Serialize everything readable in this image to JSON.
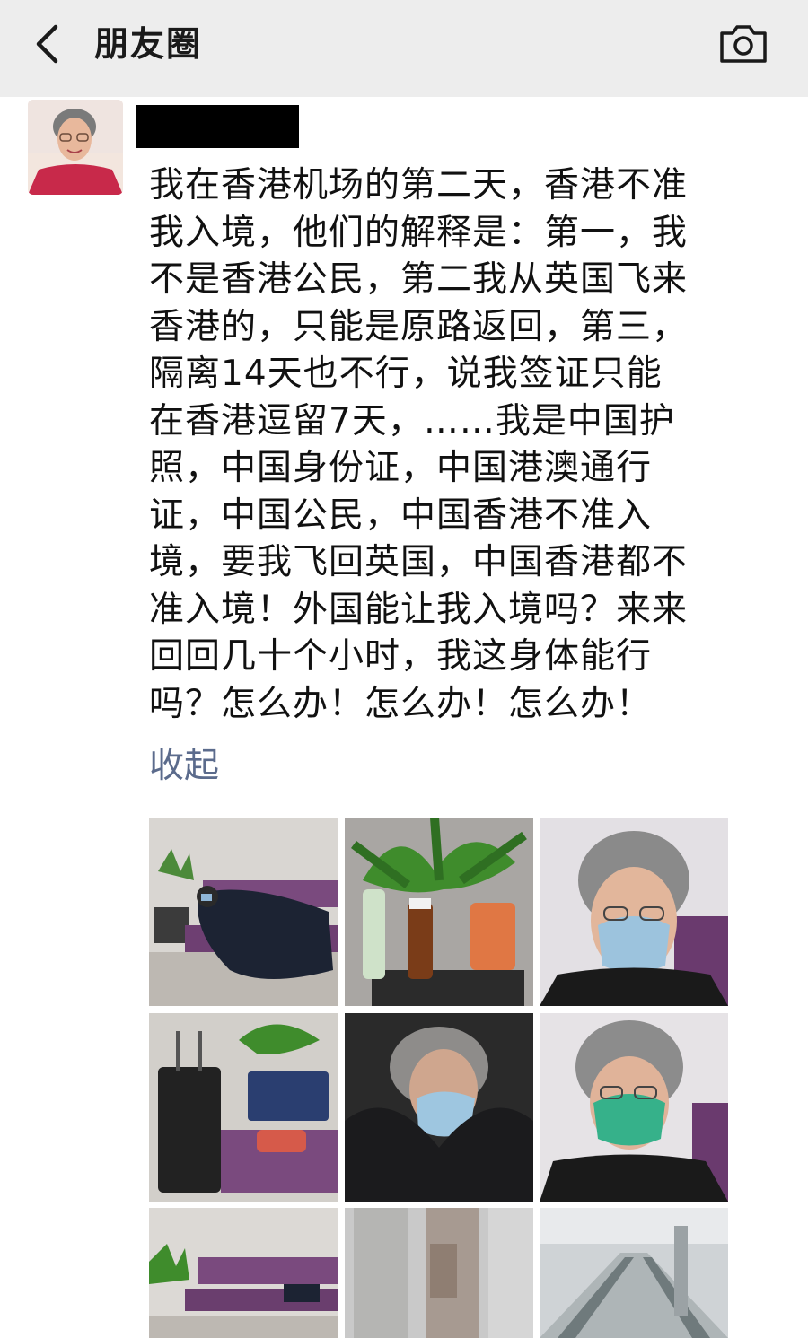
{
  "header": {
    "title": "朋友圈",
    "back_icon": "chevron-left-icon",
    "camera_icon": "camera-icon"
  },
  "post": {
    "text_lines": [
      "我在香港机场的第二天，香港不准",
      "我入境，他们的解释是：第一，我",
      "不是香港公民，第二我从英国飞来",
      "香港的，只能是原路返回，第三，",
      "隔离14天也不行，说我签证只能",
      "在香港逗留7天，……我是中国护",
      "照，中国身份证，中国港澳通行",
      "证，中国公民，中国香港不准入",
      "境，要我飞回英国，中国香港都不",
      "准入境！外国能让我入境吗？来来",
      "回回几十个小时，我这身体能行",
      "吗？怎么办！怎么办！怎么办！"
    ],
    "collapse_label": "收起"
  },
  "colors": {
    "topbar_bg": "#ededed",
    "link": "#5b6b8c",
    "text": "#111111"
  }
}
